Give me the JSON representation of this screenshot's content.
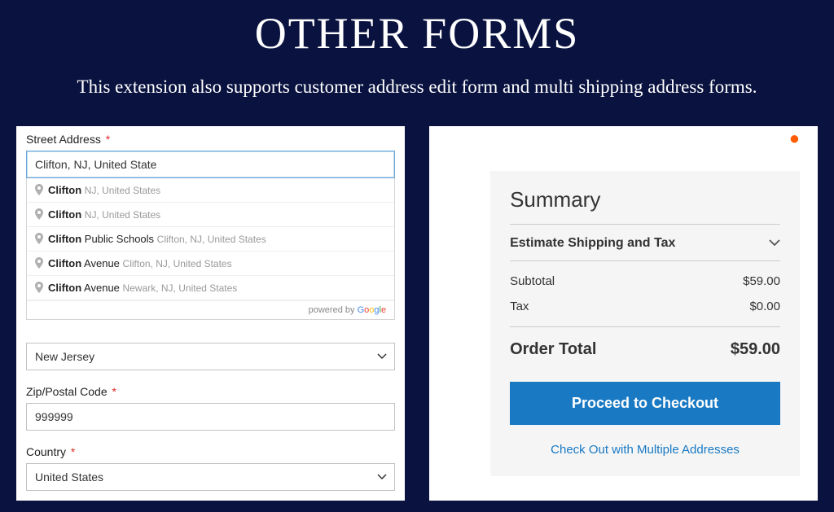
{
  "header": {
    "title": "OTHER FORMS",
    "subtitle": "This extension also supports customer address edit form and multi shipping address forms."
  },
  "form": {
    "street_label": "Street Address",
    "street_value": "Clifton, NJ, United State",
    "suggestions": [
      {
        "main": "Clifton",
        "extra": "",
        "secondary": "NJ, United States"
      },
      {
        "main": "Clifton",
        "extra": "",
        "secondary": "NJ, United States"
      },
      {
        "main": "Clifton",
        "extra": " Public Schools",
        "secondary": "Clifton, NJ, United States"
      },
      {
        "main": "Clifton",
        "extra": " Avenue",
        "secondary": "Clifton, NJ, United States"
      },
      {
        "main": "Clifton",
        "extra": " Avenue",
        "secondary": "Newark, NJ, United States"
      }
    ],
    "powered_by_label": "powered by ",
    "state_value": "New Jersey",
    "zip_label": "Zip/Postal Code",
    "zip_value": "999999",
    "country_label": "Country",
    "country_value": "United States"
  },
  "summary": {
    "title": "Summary",
    "estimate_label": "Estimate Shipping and Tax",
    "subtotal_label": "Subtotal",
    "subtotal_value": "$59.00",
    "tax_label": "Tax",
    "tax_value": "$0.00",
    "order_total_label": "Order Total",
    "order_total_value": "$59.00",
    "checkout_label": "Proceed to Checkout",
    "multi_label": "Check Out with Multiple Addresses"
  }
}
